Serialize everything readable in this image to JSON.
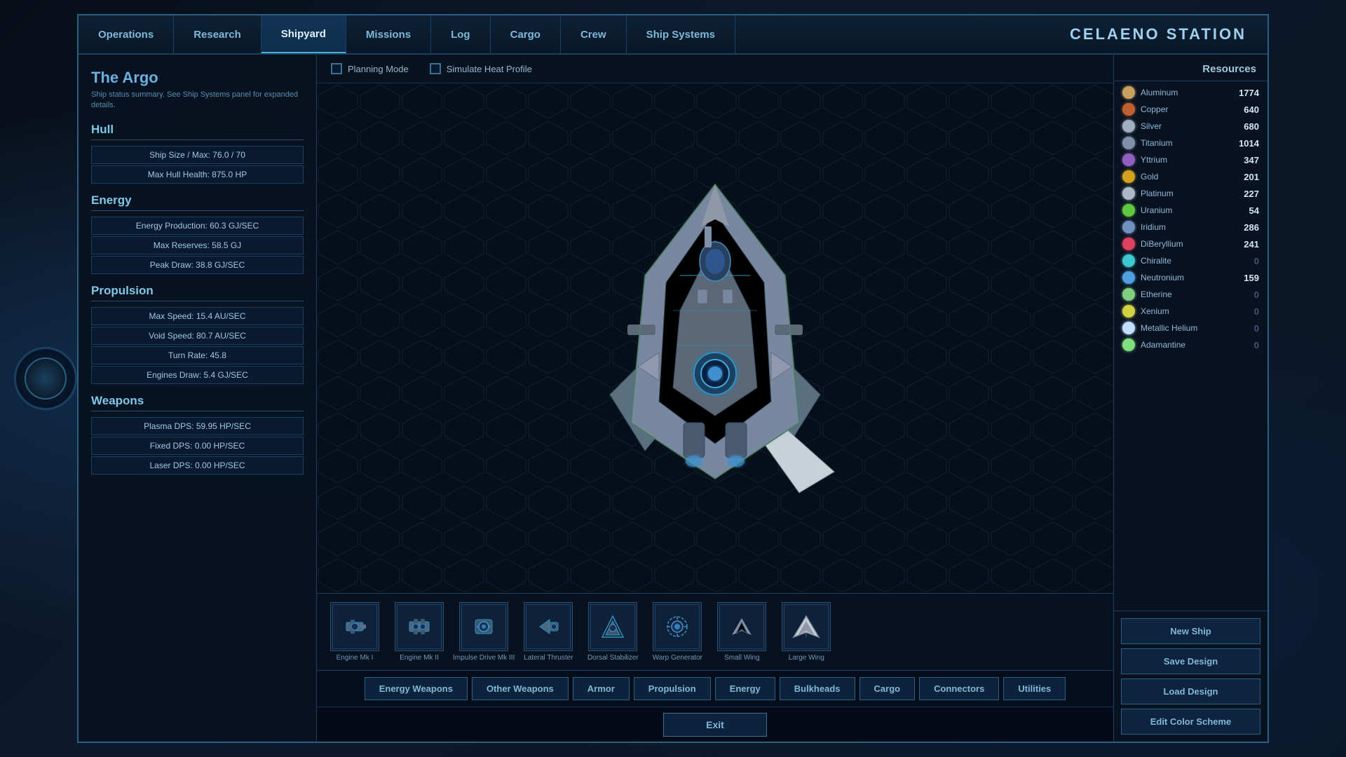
{
  "station": {
    "name": "CELAENO STATION"
  },
  "nav": {
    "tabs": [
      {
        "id": "operations",
        "label": "Operations",
        "active": false
      },
      {
        "id": "research",
        "label": "Research",
        "active": false
      },
      {
        "id": "shipyard",
        "label": "Shipyard",
        "active": true
      },
      {
        "id": "missions",
        "label": "Missions",
        "active": false
      },
      {
        "id": "log",
        "label": "Log",
        "active": false
      },
      {
        "id": "cargo",
        "label": "Cargo",
        "active": false
      },
      {
        "id": "crew",
        "label": "Crew",
        "active": false
      },
      {
        "id": "ship_systems",
        "label": "Ship Systems",
        "active": false
      }
    ]
  },
  "ship": {
    "name": "The Argo",
    "subtitle": "Ship status summary. See Ship Systems panel for expanded details.",
    "hull": {
      "header": "Hull",
      "ship_size": "Ship Size / Max: 76.0 / 70",
      "max_hull_health": "Max Hull Health: 875.0 HP"
    },
    "energy": {
      "header": "Energy",
      "production": "Energy Production: 60.3 GJ/SEC",
      "max_reserves": "Max Reserves: 58.5 GJ",
      "peak_draw": "Peak Draw: 38.8 GJ/SEC"
    },
    "propulsion": {
      "header": "Propulsion",
      "max_speed": "Max Speed: 15.4 AU/SEC",
      "void_speed": "Void Speed: 80.7 AU/SEC",
      "turn_rate": "Turn Rate: 45.8",
      "engines_draw": "Engines Draw: 5.4 GJ/SEC"
    },
    "weapons": {
      "header": "Weapons",
      "plasma_dps": "Plasma DPS: 59.95 HP/SEC",
      "fixed_dps": "Fixed DPS: 0.00 HP/SEC",
      "laser_dps": "Laser DPS: 0.00 HP/SEC"
    }
  },
  "planning": {
    "planning_mode": "Planning Mode",
    "simulate_heat": "Simulate Heat Profile"
  },
  "components": {
    "items": [
      {
        "id": "engine_mk1",
        "label": "Engine Mk I",
        "icon": "⚙"
      },
      {
        "id": "engine_mk2",
        "label": "Engine Mk II",
        "icon": "⚙"
      },
      {
        "id": "impulse_mk3",
        "label": "Impulse Drive Mk III",
        "icon": "🔧"
      },
      {
        "id": "lateral_thruster",
        "label": "Lateral Thruster",
        "icon": "◀"
      },
      {
        "id": "dorsal_stabilizer",
        "label": "Dorsal Stabilizer",
        "icon": "◈"
      },
      {
        "id": "warp_generator",
        "label": "Warp Generator",
        "icon": "✦"
      },
      {
        "id": "small_wing",
        "label": "Small Wing",
        "icon": "◂"
      },
      {
        "id": "large_wing",
        "label": "Large Wing",
        "icon": "◃"
      }
    ]
  },
  "categories": {
    "buttons": [
      {
        "id": "energy_weapons",
        "label": "Energy Weapons"
      },
      {
        "id": "other_weapons",
        "label": "Other Weapons"
      },
      {
        "id": "armor",
        "label": "Armor"
      },
      {
        "id": "propulsion",
        "label": "Propulsion"
      },
      {
        "id": "energy",
        "label": "Energy"
      },
      {
        "id": "bulkheads",
        "label": "Bulkheads"
      },
      {
        "id": "cargo",
        "label": "Cargo"
      },
      {
        "id": "connectors",
        "label": "Connectors"
      },
      {
        "id": "utilities",
        "label": "Utilities"
      }
    ]
  },
  "resources": {
    "header": "Resources",
    "items": [
      {
        "name": "Aluminum",
        "value": "1774",
        "color": "#c8a060",
        "zero": false
      },
      {
        "name": "Copper",
        "value": "640",
        "color": "#c06030",
        "zero": false
      },
      {
        "name": "Silver",
        "value": "680",
        "color": "#a0b0c0",
        "zero": false
      },
      {
        "name": "Titanium",
        "value": "1014",
        "color": "#8090a8",
        "zero": false
      },
      {
        "name": "Yttrium",
        "value": "347",
        "color": "#9060c0",
        "zero": false
      },
      {
        "name": "Gold",
        "value": "201",
        "color": "#d4a020",
        "zero": false
      },
      {
        "name": "Platinum",
        "value": "227",
        "color": "#b0b8c8",
        "zero": false
      },
      {
        "name": "Uranium",
        "value": "54",
        "color": "#60c840",
        "zero": false
      },
      {
        "name": "Iridium",
        "value": "286",
        "color": "#7090c0",
        "zero": false
      },
      {
        "name": "DiBeryllium",
        "value": "241",
        "color": "#e04060",
        "zero": false
      },
      {
        "name": "Chiralite",
        "value": "0",
        "color": "#40c8d0",
        "zero": true
      },
      {
        "name": "Neutronium",
        "value": "159",
        "color": "#50a0e0",
        "zero": false
      },
      {
        "name": "Etherine",
        "value": "0",
        "color": "#80d080",
        "zero": true
      },
      {
        "name": "Xenium",
        "value": "0",
        "color": "#d0d040",
        "zero": true
      },
      {
        "name": "Metallic Helium",
        "value": "0",
        "color": "#c0e0ff",
        "zero": true
      },
      {
        "name": "Adamantine",
        "value": "0",
        "color": "#80e080",
        "zero": true
      }
    ]
  },
  "actions": {
    "new_ship": "New Ship",
    "save_design": "Save Design",
    "load_design": "Load Design",
    "edit_color": "Edit Color Scheme"
  },
  "exit": {
    "label": "Exit"
  }
}
